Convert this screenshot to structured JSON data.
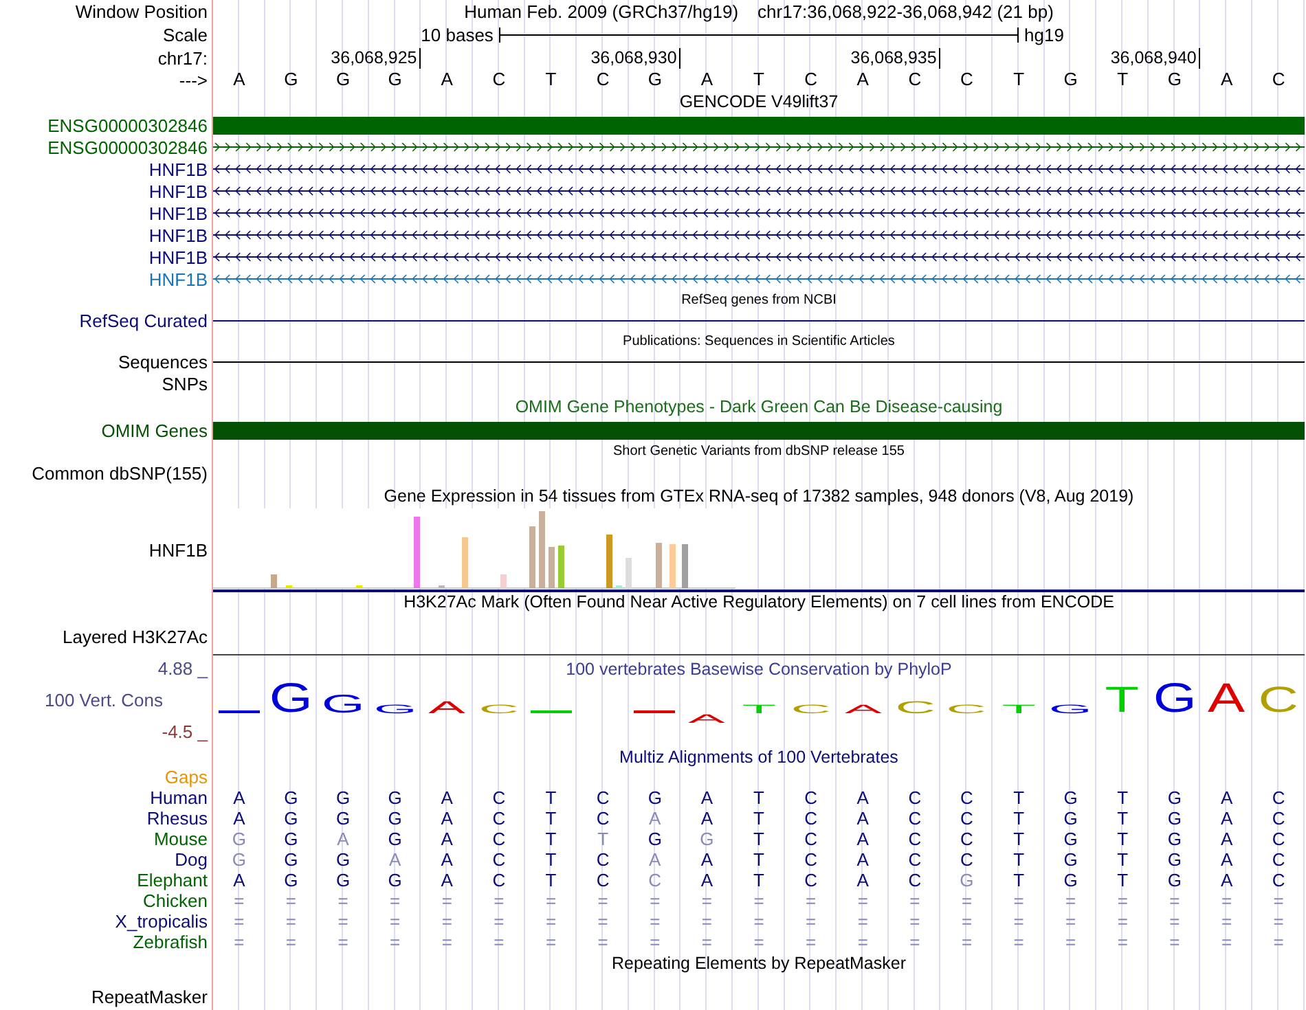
{
  "header": {
    "position_label": "Window Position",
    "assembly": "Human Feb. 2009 (GRCh37/hg19)",
    "position": "chr17:36,068,922-36,068,942 (21 bp)",
    "scale_label": "Scale",
    "scale_text": "10 bases",
    "scale_db": "hg19",
    "chrom_label": "chr17:",
    "ticks": [
      "36,068,925",
      "36,068,930",
      "36,068,935",
      "36,068,940"
    ],
    "strand_label": "--->",
    "bases": [
      "A",
      "G",
      "G",
      "G",
      "A",
      "C",
      "T",
      "C",
      "G",
      "A",
      "T",
      "C",
      "A",
      "C",
      "C",
      "T",
      "G",
      "T",
      "G",
      "A",
      "C"
    ]
  },
  "tracks": [
    {
      "kind": "title",
      "text": "GENCODE V49lift37",
      "color": "#000000"
    },
    {
      "kind": "gene-bar",
      "label": "ENSG00000302846",
      "color": "#006400"
    },
    {
      "kind": "gene-right",
      "label": "ENSG00000302846",
      "color": "#006400"
    },
    {
      "kind": "gene-left",
      "label": "HNF1B",
      "color": "#0c0c78"
    },
    {
      "kind": "gene-left",
      "label": "HNF1B",
      "color": "#0c0c78"
    },
    {
      "kind": "gene-left",
      "label": "HNF1B",
      "color": "#0c0c78"
    },
    {
      "kind": "gene-left",
      "label": "HNF1B",
      "color": "#0c0c78"
    },
    {
      "kind": "gene-left",
      "label": "HNF1B",
      "color": "#0c0c78"
    },
    {
      "kind": "gene-left",
      "label": "HNF1B",
      "color": "#1a74b8"
    },
    {
      "kind": "title-small",
      "text": "RefSeq genes from NCBI",
      "color": "#000000"
    },
    {
      "kind": "line",
      "label": "RefSeq Curated",
      "color": "#0c0c78"
    },
    {
      "kind": "title-small",
      "text": "Publications: Sequences in Scientific Articles",
      "color": "#000000"
    },
    {
      "kind": "line",
      "label": "Sequences",
      "color": "#000000"
    },
    {
      "kind": "empty",
      "label": "SNPs",
      "color": "#000000"
    },
    {
      "kind": "title",
      "text": "OMIM Gene Phenotypes - Dark Green Can Be Disease-causing",
      "color": "#1a6e1a"
    },
    {
      "kind": "gene-bar",
      "label": "OMIM Genes",
      "color": "#045004"
    },
    {
      "kind": "title-small",
      "text": "Short Genetic Variants from dbSNP release 155",
      "color": "#000000"
    },
    {
      "kind": "empty",
      "label": "Common dbSNP(155)",
      "color": "#000000"
    },
    {
      "kind": "title",
      "text": "Gene Expression in 54 tissues from GTEx RNA-seq of 17382 samples, 948 donors (V8, Aug 2019)",
      "color": "#000000"
    },
    {
      "kind": "chart",
      "label": "HNF1B",
      "color": "#000000"
    },
    {
      "kind": "title-tall",
      "text": "H3K27Ac Mark (Often Found Near Active Regulatory Elements) on 7 cell lines from ENCODE",
      "color": "#000000"
    },
    {
      "kind": "empty-tall",
      "label": "Layered H3K27Ac",
      "color": "#000000"
    },
    {
      "kind": "conservation",
      "title": "100 vertebrates Basewise Conservation by PhyloP",
      "label": "100 Vert. Cons",
      "max": "4.88 _",
      "min": "-4.5 _",
      "letters": [
        {
          "kind": "mark",
          "color": "#0000d8"
        },
        {
          "kind": "up",
          "base": "G",
          "color": "#0000d8"
        },
        {
          "kind": "up",
          "base": "G",
          "color": "#0000d8"
        },
        {
          "kind": "up",
          "base": "G",
          "color": "#0000d8"
        },
        {
          "kind": "up",
          "base": "A",
          "color": "#e00000"
        },
        {
          "kind": "up",
          "base": "C",
          "color": "#b0a000"
        },
        {
          "kind": "mark",
          "color": "#00d000"
        },
        {
          "kind": "blank"
        },
        {
          "kind": "mark",
          "color": "#e00000"
        },
        {
          "kind": "down",
          "base": "A",
          "color": "#e00000"
        },
        {
          "kind": "up",
          "base": "T",
          "color": "#00d000"
        },
        {
          "kind": "up",
          "base": "C",
          "color": "#b0a000"
        },
        {
          "kind": "up",
          "base": "A",
          "color": "#e00000"
        },
        {
          "kind": "up",
          "base": "C",
          "color": "#b0a000"
        },
        {
          "kind": "up",
          "base": "C",
          "color": "#b0a000"
        },
        {
          "kind": "up",
          "base": "T",
          "color": "#00d000"
        },
        {
          "kind": "up",
          "base": "G",
          "color": "#0000d8"
        },
        {
          "kind": "up",
          "base": "T",
          "color": "#00d000"
        },
        {
          "kind": "up",
          "base": "G",
          "color": "#0000d8"
        },
        {
          "kind": "up",
          "base": "A",
          "color": "#e00000"
        },
        {
          "kind": "up",
          "base": "C",
          "color": "#b0a000"
        }
      ]
    },
    {
      "kind": "title",
      "text": "Multiz Alignments of 100 Vertebrates",
      "color": "#0c0c78"
    },
    {
      "kind": "gaps",
      "label": "Gaps",
      "color": "#e89400"
    },
    {
      "kind": "alignment",
      "label": "Human",
      "color": "#0c0c78",
      "bases": [
        {
          "base": "A",
          "match": true
        },
        {
          "base": "G",
          "match": true
        },
        {
          "base": "G",
          "match": true
        },
        {
          "base": "G",
          "match": true
        },
        {
          "base": "A",
          "match": true
        },
        {
          "base": "C",
          "match": true
        },
        {
          "base": "T",
          "match": true
        },
        {
          "base": "C",
          "match": true
        },
        {
          "base": "G",
          "match": true
        },
        {
          "base": "A",
          "match": true
        },
        {
          "base": "T",
          "match": true
        },
        {
          "base": "C",
          "match": true
        },
        {
          "base": "A",
          "match": true
        },
        {
          "base": "C",
          "match": true
        },
        {
          "base": "C",
          "match": true
        },
        {
          "base": "T",
          "match": true
        },
        {
          "base": "G",
          "match": true
        },
        {
          "base": "T",
          "match": true
        },
        {
          "base": "G",
          "match": true
        },
        {
          "base": "A",
          "match": true
        },
        {
          "base": "C",
          "match": true
        }
      ]
    },
    {
      "kind": "alignment",
      "label": "Rhesus",
      "color": "#0c0c78",
      "bases": [
        {
          "base": "A",
          "match": true
        },
        {
          "base": "G",
          "match": true
        },
        {
          "base": "G",
          "match": true
        },
        {
          "base": "G",
          "match": true
        },
        {
          "base": "A",
          "match": true
        },
        {
          "base": "C",
          "match": true
        },
        {
          "base": "T",
          "match": true
        },
        {
          "base": "C",
          "match": true
        },
        {
          "base": "A",
          "match": false
        },
        {
          "base": "A",
          "match": true
        },
        {
          "base": "T",
          "match": true
        },
        {
          "base": "C",
          "match": true
        },
        {
          "base": "A",
          "match": true
        },
        {
          "base": "C",
          "match": true
        },
        {
          "base": "C",
          "match": true
        },
        {
          "base": "T",
          "match": true
        },
        {
          "base": "G",
          "match": true
        },
        {
          "base": "T",
          "match": true
        },
        {
          "base": "G",
          "match": true
        },
        {
          "base": "A",
          "match": true
        },
        {
          "base": "C",
          "match": true
        }
      ]
    },
    {
      "kind": "alignment",
      "label": "Mouse",
      "color": "#006400",
      "bases": [
        {
          "base": "G",
          "match": false
        },
        {
          "base": "G",
          "match": true
        },
        {
          "base": "A",
          "match": false
        },
        {
          "base": "G",
          "match": true
        },
        {
          "base": "A",
          "match": true
        },
        {
          "base": "C",
          "match": true
        },
        {
          "base": "T",
          "match": true
        },
        {
          "base": "T",
          "match": false
        },
        {
          "base": "G",
          "match": true
        },
        {
          "base": "G",
          "match": false
        },
        {
          "base": "T",
          "match": true
        },
        {
          "base": "C",
          "match": true
        },
        {
          "base": "A",
          "match": true
        },
        {
          "base": "C",
          "match": true
        },
        {
          "base": "C",
          "match": true
        },
        {
          "base": "T",
          "match": true
        },
        {
          "base": "G",
          "match": true
        },
        {
          "base": "T",
          "match": true
        },
        {
          "base": "G",
          "match": true
        },
        {
          "base": "A",
          "match": true
        },
        {
          "base": "C",
          "match": true
        }
      ]
    },
    {
      "kind": "alignment",
      "label": "Dog",
      "color": "#0c0c78",
      "bases": [
        {
          "base": "G",
          "match": false
        },
        {
          "base": "G",
          "match": true
        },
        {
          "base": "G",
          "match": true
        },
        {
          "base": "A",
          "match": false
        },
        {
          "base": "A",
          "match": true
        },
        {
          "base": "C",
          "match": true
        },
        {
          "base": "T",
          "match": true
        },
        {
          "base": "C",
          "match": true
        },
        {
          "base": "A",
          "match": false
        },
        {
          "base": "A",
          "match": true
        },
        {
          "base": "T",
          "match": true
        },
        {
          "base": "C",
          "match": true
        },
        {
          "base": "A",
          "match": true
        },
        {
          "base": "C",
          "match": true
        },
        {
          "base": "C",
          "match": true
        },
        {
          "base": "T",
          "match": true
        },
        {
          "base": "G",
          "match": true
        },
        {
          "base": "T",
          "match": true
        },
        {
          "base": "G",
          "match": true
        },
        {
          "base": "A",
          "match": true
        },
        {
          "base": "C",
          "match": true
        }
      ]
    },
    {
      "kind": "alignment",
      "label": "Elephant",
      "color": "#006400",
      "bases": [
        {
          "base": "A",
          "match": true
        },
        {
          "base": "G",
          "match": true
        },
        {
          "base": "G",
          "match": true
        },
        {
          "base": "G",
          "match": true
        },
        {
          "base": "A",
          "match": true
        },
        {
          "base": "C",
          "match": true
        },
        {
          "base": "T",
          "match": true
        },
        {
          "base": "C",
          "match": true
        },
        {
          "base": "C",
          "match": false
        },
        {
          "base": "A",
          "match": true
        },
        {
          "base": "T",
          "match": true
        },
        {
          "base": "C",
          "match": true
        },
        {
          "base": "A",
          "match": true
        },
        {
          "base": "C",
          "match": true
        },
        {
          "base": "G",
          "match": false
        },
        {
          "base": "T",
          "match": true
        },
        {
          "base": "G",
          "match": true
        },
        {
          "base": "T",
          "match": true
        },
        {
          "base": "G",
          "match": true
        },
        {
          "base": "A",
          "match": true
        },
        {
          "base": "C",
          "match": true
        }
      ]
    },
    {
      "kind": "alignment",
      "label": "Chicken",
      "color": "#006400",
      "bases": [
        {
          "base": "=",
          "match": false
        },
        {
          "base": "=",
          "match": false
        },
        {
          "base": "=",
          "match": false
        },
        {
          "base": "=",
          "match": false
        },
        {
          "base": "=",
          "match": false
        },
        {
          "base": "=",
          "match": false
        },
        {
          "base": "=",
          "match": false
        },
        {
          "base": "=",
          "match": false
        },
        {
          "base": "=",
          "match": false
        },
        {
          "base": "=",
          "match": false
        },
        {
          "base": "=",
          "match": false
        },
        {
          "base": "=",
          "match": false
        },
        {
          "base": "=",
          "match": false
        },
        {
          "base": "=",
          "match": false
        },
        {
          "base": "=",
          "match": false
        },
        {
          "base": "=",
          "match": false
        },
        {
          "base": "=",
          "match": false
        },
        {
          "base": "=",
          "match": false
        },
        {
          "base": "=",
          "match": false
        },
        {
          "base": "=",
          "match": false
        },
        {
          "base": "=",
          "match": false
        }
      ]
    },
    {
      "kind": "alignment",
      "label": "X_tropicalis",
      "color": "#0c0c78",
      "bases": [
        {
          "base": "=",
          "match": false
        },
        {
          "base": "=",
          "match": false
        },
        {
          "base": "=",
          "match": false
        },
        {
          "base": "=",
          "match": false
        },
        {
          "base": "=",
          "match": false
        },
        {
          "base": "=",
          "match": false
        },
        {
          "base": "=",
          "match": false
        },
        {
          "base": "=",
          "match": false
        },
        {
          "base": "=",
          "match": false
        },
        {
          "base": "=",
          "match": false
        },
        {
          "base": "=",
          "match": false
        },
        {
          "base": "=",
          "match": false
        },
        {
          "base": "=",
          "match": false
        },
        {
          "base": "=",
          "match": false
        },
        {
          "base": "=",
          "match": false
        },
        {
          "base": "=",
          "match": false
        },
        {
          "base": "=",
          "match": false
        },
        {
          "base": "=",
          "match": false
        },
        {
          "base": "=",
          "match": false
        },
        {
          "base": "=",
          "match": false
        },
        {
          "base": "=",
          "match": false
        }
      ]
    },
    {
      "kind": "alignment",
      "label": "Zebrafish",
      "color": "#006400",
      "bases": [
        {
          "base": "=",
          "match": false
        },
        {
          "base": "=",
          "match": false
        },
        {
          "base": "=",
          "match": false
        },
        {
          "base": "=",
          "match": false
        },
        {
          "base": "=",
          "match": false
        },
        {
          "base": "=",
          "match": false
        },
        {
          "base": "=",
          "match": false
        },
        {
          "base": "=",
          "match": false
        },
        {
          "base": "=",
          "match": false
        },
        {
          "base": "=",
          "match": false
        },
        {
          "base": "=",
          "match": false
        },
        {
          "base": "=",
          "match": false
        },
        {
          "base": "=",
          "match": false
        },
        {
          "base": "=",
          "match": false
        },
        {
          "base": "=",
          "match": false
        },
        {
          "base": "=",
          "match": false
        },
        {
          "base": "=",
          "match": false
        },
        {
          "base": "=",
          "match": false
        },
        {
          "base": "=",
          "match": false
        },
        {
          "base": "=",
          "match": false
        },
        {
          "base": "=",
          "match": false
        }
      ]
    },
    {
      "kind": "title",
      "text": "Repeating Elements by RepeatMasker",
      "color": "#000000"
    },
    {
      "kind": "empty-tall",
      "label": "RepeatMasker",
      "color": "#000000"
    }
  ]
}
